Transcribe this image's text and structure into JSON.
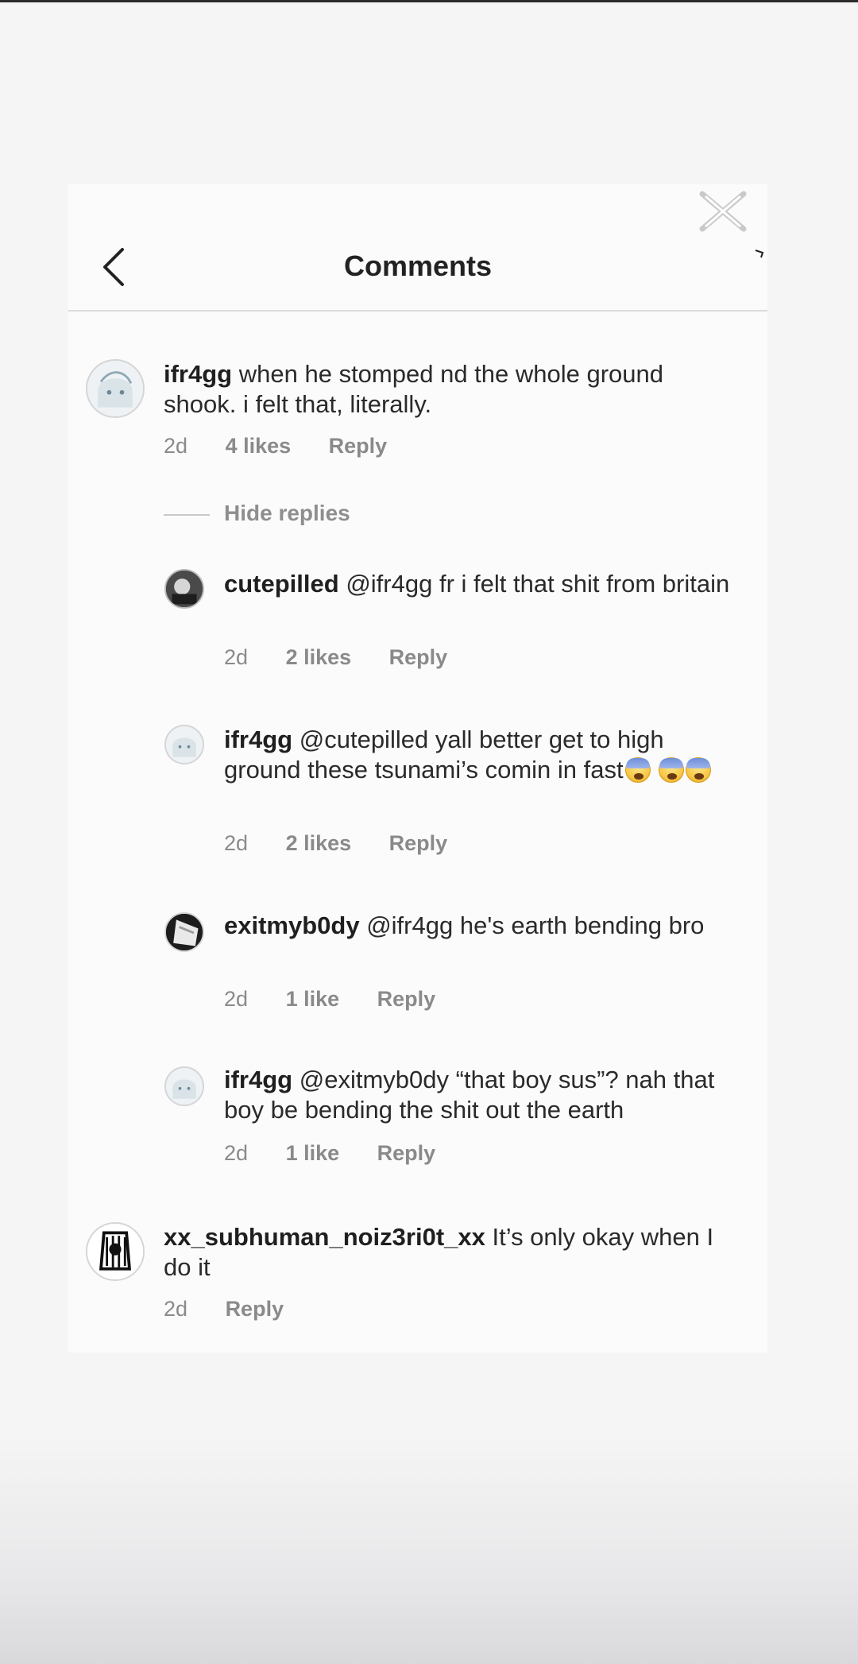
{
  "header": {
    "title": "Comments",
    "back_icon": "chevron-left-icon",
    "close_icon": "close-icon"
  },
  "comments": [
    {
      "username": "ifr4gg",
      "text": "when he stomped nd the whole ground shook. i felt that, literally.",
      "time": "2d",
      "likes": "4 likes",
      "reply": "Reply"
    },
    {
      "username": "xx_subhuman_noiz3ri0t_xx",
      "text": "It’s only okay when I do it",
      "time": "2d",
      "reply": "Reply"
    }
  ],
  "hide_replies_label": "Hide replies",
  "replies": [
    {
      "username": "cutepilled",
      "mention": "@ifr4gg",
      "text": "fr i felt that shit from britain",
      "time": "2d",
      "likes": "2 likes",
      "reply": "Reply"
    },
    {
      "username": "ifr4gg",
      "mention": "@cutepilled",
      "text": "yall better get to high ground these tsunami’s comin in fast",
      "time": "2d",
      "likes": "2 likes",
      "reply": "Reply"
    },
    {
      "username": "exitmyb0dy",
      "mention": "@ifr4gg",
      "text": "he's earth bending bro",
      "time": "2d",
      "likes": "1 like",
      "reply": "Reply"
    },
    {
      "username": "ifr4gg",
      "mention": "@exitmyb0dy",
      "text": "“that boy sus”? nah that boy be bending the shit out the earth",
      "time": "2d",
      "likes": "1 like",
      "reply": "Reply"
    }
  ],
  "colors": {
    "background": "#f5f5f6",
    "text": "#262626",
    "meta": "#8a8a8a"
  }
}
